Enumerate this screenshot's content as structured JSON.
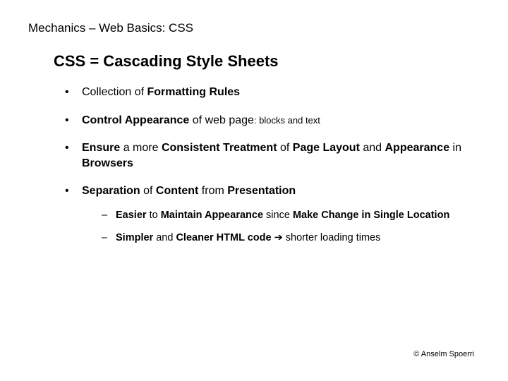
{
  "header": "Mechanics – Web Basics: CSS",
  "title": "CSS = Cascading Style Sheets",
  "bullets": {
    "b1_pre": "Collection of ",
    "b1_bold": "Formatting Rules",
    "b2_bold": "Control Appearance",
    "b2_mid": " of web page",
    "b2_small": ": blocks and text",
    "b3_a": "Ensure",
    "b3_b": " a more ",
    "b3_c": "Consistent Treatment",
    "b3_d": " of ",
    "b3_e": "Page Layout",
    "b3_f": " and ",
    "b3_g": "Appearance",
    "b3_h": " in ",
    "b3_i": "Browsers",
    "b4_a": "Separation",
    "b4_b": " of ",
    "b4_c": "Content",
    "b4_d": " from ",
    "b4_e": "Presentation"
  },
  "sub": {
    "s1_a": "Easier",
    "s1_b": " to ",
    "s1_c": "Maintain Appearance",
    "s1_d": " since ",
    "s1_e": "Make Change in Single Location",
    "s2_a": "Simpler",
    "s2_b": " and ",
    "s2_c": "Cleaner HTML code",
    "s2_arrow": " ➔ ",
    "s2_d": " shorter loading times"
  },
  "footer": "© Anselm Spoerri"
}
